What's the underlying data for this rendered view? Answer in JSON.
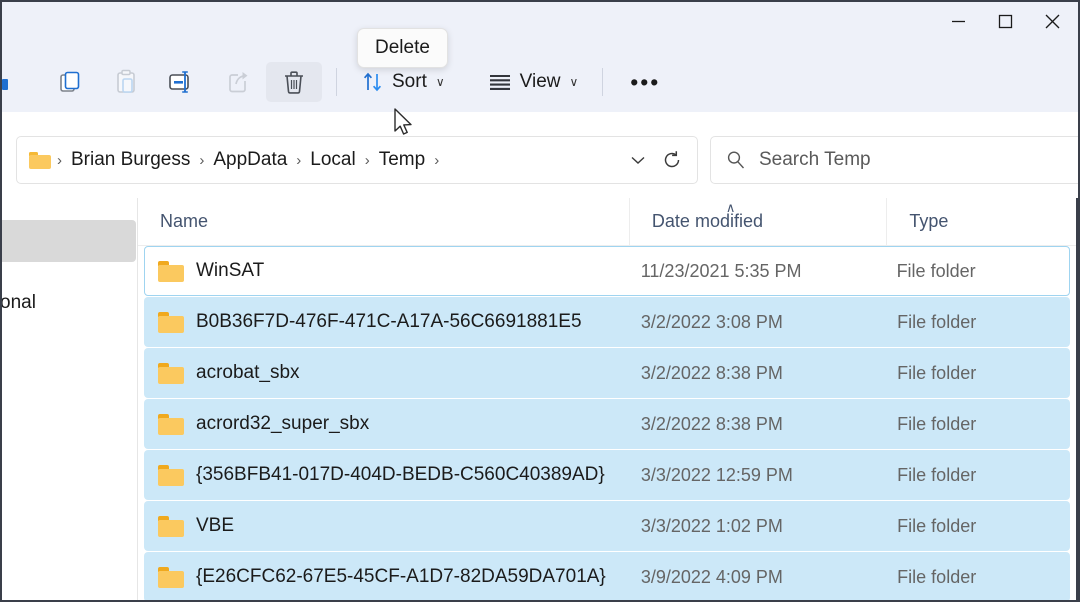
{
  "window": {
    "caption_buttons": [
      {
        "name": "minimize",
        "glyph": "minimize-icon"
      },
      {
        "name": "maximize",
        "glyph": "maximize-icon"
      },
      {
        "name": "close",
        "glyph": "close-icon"
      }
    ]
  },
  "toolbar": {
    "items": [
      {
        "name": "copy",
        "icon": "copy-icon",
        "enabled": true
      },
      {
        "name": "paste",
        "icon": "paste-icon",
        "enabled": false
      },
      {
        "name": "rename",
        "icon": "rename-icon",
        "enabled": true
      },
      {
        "name": "share",
        "icon": "share-icon",
        "enabled": false
      },
      {
        "name": "delete",
        "icon": "trash-icon",
        "enabled": true,
        "hovered": true
      }
    ],
    "sort_label": "Sort",
    "view_label": "View",
    "more_label": "•••",
    "chevron": "∨"
  },
  "tooltip": {
    "text": "Delete"
  },
  "address": {
    "crumbs": [
      "Brian Burgess",
      "AppData",
      "Local",
      "Temp"
    ],
    "separator": "›",
    "trailing_separator": "›",
    "history_chevron": "chevron-down-icon",
    "refresh": "refresh-icon"
  },
  "search": {
    "placeholder": "Search Temp",
    "icon": "search-icon"
  },
  "sidebar": {
    "partial_label": "onal"
  },
  "file_list": {
    "columns": [
      {
        "key": "name",
        "label": "Name",
        "sorted": false
      },
      {
        "key": "date",
        "label": "Date modified",
        "sorted": true,
        "sort_caret": "∧"
      },
      {
        "key": "type",
        "label": "Type",
        "sorted": false
      }
    ],
    "rows": [
      {
        "name": "WinSAT",
        "date": "11/23/2021 5:35 PM",
        "type": "File folder",
        "selected": false,
        "focused": true
      },
      {
        "name": "B0B36F7D-476F-471C-A17A-56C6691881E5",
        "date": "3/2/2022 3:08 PM",
        "type": "File folder",
        "selected": true,
        "focused": false
      },
      {
        "name": "acrobat_sbx",
        "date": "3/2/2022 8:38 PM",
        "type": "File folder",
        "selected": true,
        "focused": false
      },
      {
        "name": "acrord32_super_sbx",
        "date": "3/2/2022 8:38 PM",
        "type": "File folder",
        "selected": true,
        "focused": false
      },
      {
        "name": "{356BFB41-017D-404D-BEDB-C560C40389AD}",
        "date": "3/3/2022 12:59 PM",
        "type": "File folder",
        "selected": true,
        "focused": false
      },
      {
        "name": "VBE",
        "date": "3/3/2022 1:02 PM",
        "type": "File folder",
        "selected": true,
        "focused": false
      },
      {
        "name": "{E26CFC62-67E5-45CF-A1D7-82DA59DA701A}",
        "date": "3/9/2022 4:09 PM",
        "type": "File folder",
        "selected": true,
        "focused": false
      }
    ]
  },
  "colors": {
    "toolbar_bg": "#eef1f9",
    "selection": "#cce8f8",
    "focus_outline": "#9fd4f0",
    "folder_yellow": "#fbc95f",
    "accent_blue": "#1f6fd0",
    "header_text": "#44546f"
  }
}
